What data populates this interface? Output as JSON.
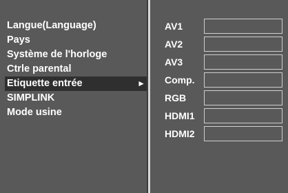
{
  "menu": {
    "items": [
      {
        "label": "Langue(Language)",
        "selected": false
      },
      {
        "label": "Pays",
        "selected": false
      },
      {
        "label": "Système de l'horloge",
        "selected": false
      },
      {
        "label": "Ctrle parental",
        "selected": false
      },
      {
        "label": "Etiquette entrée",
        "selected": true,
        "arrow": "►"
      },
      {
        "label": "SIMPLINK",
        "selected": false
      },
      {
        "label": "Mode usine",
        "selected": false
      }
    ]
  },
  "inputs": [
    {
      "name": "AV1",
      "value": ""
    },
    {
      "name": "AV2",
      "value": ""
    },
    {
      "name": "AV3",
      "value": ""
    },
    {
      "name": "Comp.",
      "value": ""
    },
    {
      "name": "RGB",
      "value": ""
    },
    {
      "name": "HDMI1",
      "value": ""
    },
    {
      "name": "HDMI2",
      "value": ""
    }
  ],
  "colors": {
    "panel": "#595959",
    "highlight": "#2f2f2f",
    "text": "#ffffff",
    "divider": "#d8d8d8"
  }
}
